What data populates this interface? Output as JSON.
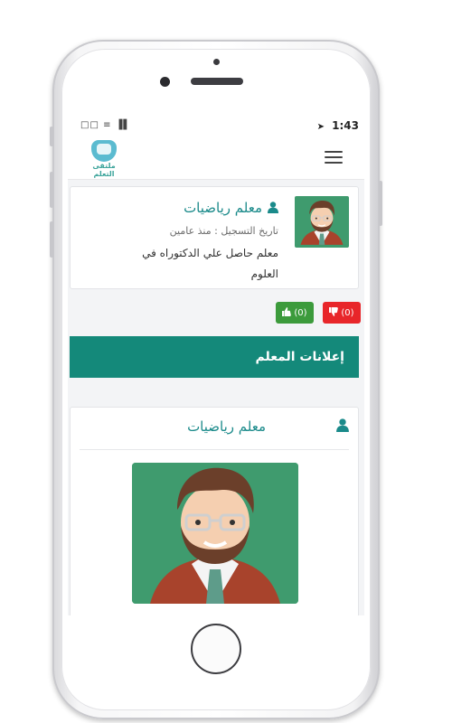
{
  "status_bar": {
    "icons": "□□ ≡ ▐▌",
    "time": "1:43",
    "location_arrow": "➤"
  },
  "app": {
    "logo_text": "ملتقى التعلم",
    "menu_icon": "hamburger-icon"
  },
  "teacher": {
    "name": "معلم رياضيات",
    "registration": "تاريخ التسجيل : منذ عامين",
    "description": "معلم حاصل علي الدكتوراه في العلوم"
  },
  "votes": {
    "dislikes": "(0)",
    "likes": "(0)"
  },
  "section": {
    "title": "إعلانات المعلم"
  },
  "ad": {
    "title": "معلم رياضيات"
  },
  "colors": {
    "primary_teal": "#14897a",
    "link_teal": "#1a8a8a",
    "like_green": "#3c9b3c",
    "dislike_red": "#e8262a"
  }
}
